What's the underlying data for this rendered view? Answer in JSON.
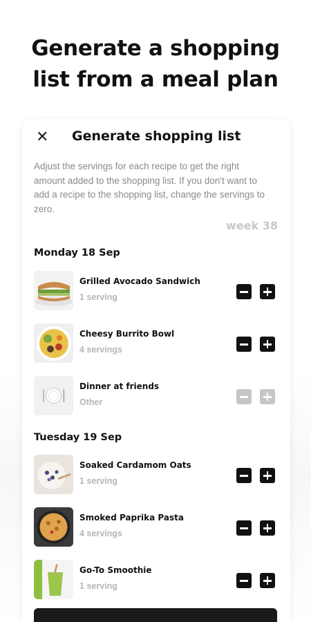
{
  "headline": {
    "line1": "Generate a shopping",
    "line2": "list from a meal plan"
  },
  "dialog": {
    "title": "Generate shopping list",
    "close_icon": "close-icon",
    "description": "Adjust the servings for each recipe to get the right amount added to the shopping list. If you don't want to add a recipe to the shopping list, change the servings to zero.",
    "week_label": "week 38"
  },
  "days": [
    {
      "label": "Monday 18 Sep",
      "recipes": [
        {
          "title": "Grilled Avocado Sandwich",
          "servings": "1 serving",
          "enabled": true
        },
        {
          "title": "Cheesy Burrito Bowl",
          "servings": "4 servings",
          "enabled": true
        },
        {
          "title": "Dinner at friends",
          "servings": "Other",
          "enabled": false
        }
      ]
    },
    {
      "label": "Tuesday 19 Sep",
      "recipes": [
        {
          "title": "Soaked Cardamom Oats",
          "servings": "1 serving",
          "enabled": true
        },
        {
          "title": "Smoked Paprika Pasta",
          "servings": "4 servings",
          "enabled": true
        },
        {
          "title": "Go-To Smoothie",
          "servings": "1 serving",
          "enabled": true
        }
      ]
    }
  ],
  "colors": {
    "button_active": "#111111",
    "button_disabled": "#c6c6c6",
    "muted_text": "#b5b5b5"
  }
}
